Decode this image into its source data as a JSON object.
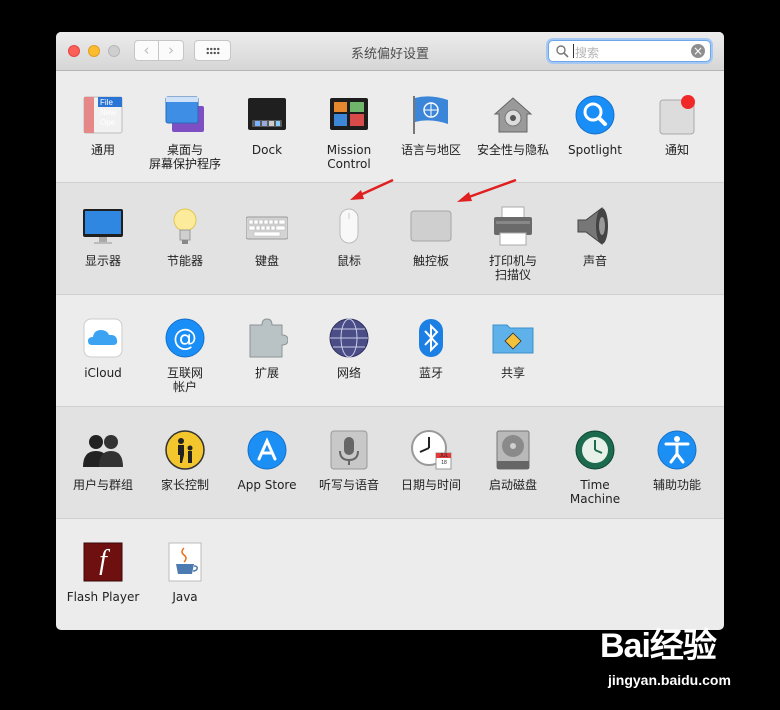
{
  "window": {
    "title": "系统偏好设置",
    "search": {
      "placeholder": "搜索"
    }
  },
  "sections": [
    {
      "items": [
        {
          "name": "general",
          "label": "通用",
          "icon": "general-icon",
          "icon_text": "File\nNew\nOpe"
        },
        {
          "name": "desktop",
          "label": "桌面与\n屏幕保护程序",
          "icon": "desktop-screensaver-icon"
        },
        {
          "name": "dock",
          "label": "Dock",
          "icon": "dock-icon"
        },
        {
          "name": "mission-control",
          "label": "Mission\nControl",
          "icon": "mission-control-icon"
        },
        {
          "name": "language",
          "label": "语言与地区",
          "icon": "language-region-flag-icon"
        },
        {
          "name": "security",
          "label": "安全性与隐私",
          "icon": "security-house-icon"
        },
        {
          "name": "spotlight",
          "label": "Spotlight",
          "icon": "spotlight-magnifier-icon"
        },
        {
          "name": "notifications",
          "label": "通知",
          "icon": "notifications-icon"
        }
      ]
    },
    {
      "items": [
        {
          "name": "displays",
          "label": "显示器",
          "icon": "display-monitor-icon"
        },
        {
          "name": "energy",
          "label": "节能器",
          "icon": "energy-bulb-icon"
        },
        {
          "name": "keyboard",
          "label": "键盘",
          "icon": "keyboard-icon"
        },
        {
          "name": "mouse",
          "label": "鼠标",
          "icon": "mouse-icon"
        },
        {
          "name": "trackpad",
          "label": "触控板",
          "icon": "trackpad-icon"
        },
        {
          "name": "printers",
          "label": "打印机与\n扫描仪",
          "icon": "printer-icon"
        },
        {
          "name": "sound",
          "label": "声音",
          "icon": "speaker-icon"
        }
      ]
    },
    {
      "items": [
        {
          "name": "icloud",
          "label": "iCloud",
          "icon": "icloud-icon"
        },
        {
          "name": "internet-accounts",
          "label": "互联网\n帐户",
          "icon": "at-sign-icon"
        },
        {
          "name": "extensions",
          "label": "扩展",
          "icon": "puzzle-piece-icon"
        },
        {
          "name": "network",
          "label": "网络",
          "icon": "network-globe-icon"
        },
        {
          "name": "bluetooth",
          "label": "蓝牙",
          "icon": "bluetooth-icon"
        },
        {
          "name": "sharing",
          "label": "共享",
          "icon": "sharing-folder-icon"
        }
      ]
    },
    {
      "items": [
        {
          "name": "users",
          "label": "用户与群组",
          "icon": "users-icon"
        },
        {
          "name": "parental",
          "label": "家长控制",
          "icon": "parental-controls-icon"
        },
        {
          "name": "app-store",
          "label": "App Store",
          "icon": "app-store-icon"
        },
        {
          "name": "dictation",
          "label": "听写与语音",
          "icon": "microphone-icon"
        },
        {
          "name": "datetime",
          "label": "日期与时间",
          "icon": "clock-calendar-icon",
          "icon_text": "JUL\n18"
        },
        {
          "name": "startup-disk",
          "label": "启动磁盘",
          "icon": "hard-disk-icon"
        },
        {
          "name": "time-machine",
          "label": "Time Machine",
          "icon": "time-machine-icon"
        },
        {
          "name": "accessibility",
          "label": "辅助功能",
          "icon": "accessibility-icon"
        }
      ]
    },
    {
      "items": [
        {
          "name": "flash",
          "label": "Flash Player",
          "icon": "flash-player-icon",
          "icon_text": "f"
        },
        {
          "name": "java",
          "label": "Java",
          "icon": "java-cup-icon"
        }
      ]
    }
  ],
  "annotations": {
    "arrows": 2,
    "color": "#e02020"
  },
  "watermark": {
    "logo": "Bai经验",
    "url": "jingyan.baidu.com"
  },
  "colors": {
    "accent": "#1a8ef7",
    "search_focus": "#6fa6e9"
  }
}
